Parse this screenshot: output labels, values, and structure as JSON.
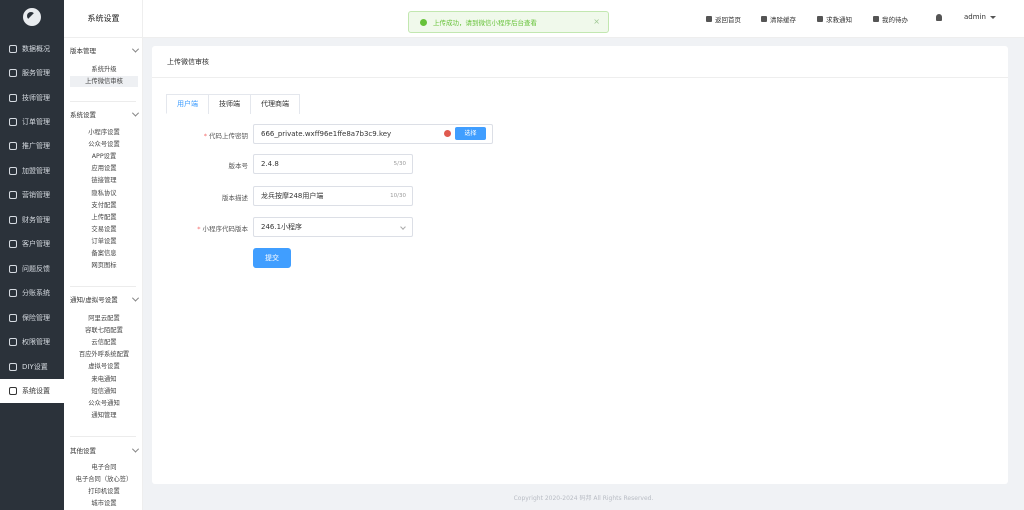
{
  "nav": {
    "items": [
      {
        "label": "数据概况",
        "icon": "dashboard-icon"
      },
      {
        "label": "服务管理",
        "icon": "service-icon"
      },
      {
        "label": "技师管理",
        "icon": "technician-icon"
      },
      {
        "label": "订单管理",
        "icon": "order-icon"
      },
      {
        "label": "推广管理",
        "icon": "promotion-icon"
      },
      {
        "label": "加盟管理",
        "icon": "franchise-icon"
      },
      {
        "label": "营销管理",
        "icon": "marketing-icon"
      },
      {
        "label": "财务管理",
        "icon": "finance-icon"
      },
      {
        "label": "客户管理",
        "icon": "customer-icon"
      },
      {
        "label": "问题反馈",
        "icon": "feedback-icon"
      },
      {
        "label": "分账系统",
        "icon": "split-icon"
      },
      {
        "label": "保险管理",
        "icon": "insurance-icon"
      },
      {
        "label": "权限管理",
        "icon": "permission-icon"
      },
      {
        "label": "DIY设置",
        "icon": "diy-icon"
      },
      {
        "label": "系统设置",
        "icon": "settings-icon"
      }
    ]
  },
  "sub": {
    "title": "系统设置",
    "groups": [
      {
        "title": "版本管理",
        "items": [
          "系统升级",
          "上传微信审核"
        ]
      },
      {
        "title": "系统设置",
        "items": [
          "小程序设置",
          "公众号设置",
          "APP设置",
          "应用设置",
          "链接管理",
          "隐私协议",
          "支付配置",
          "上传配置",
          "交易设置",
          "订单设置",
          "备案信息",
          "网页图标"
        ]
      },
      {
        "title": "通知/虚拟号设置",
        "items": [
          "阿里云配置",
          "容联七陌配置",
          "云信配置",
          "百应外呼系统配置",
          "虚拟号设置",
          "来电通知",
          "短信通知",
          "公众号通知",
          "通知管理"
        ]
      },
      {
        "title": "其他设置",
        "items": [
          "电子合同",
          "电子合同（放心签）",
          "打印机设置",
          "城市设置"
        ]
      }
    ]
  },
  "toast": {
    "message": "上传成功，请到微信小程序后台查看",
    "close": "×"
  },
  "topbar": {
    "links": [
      {
        "label": "返回首页",
        "icon": "home-icon"
      },
      {
        "label": "清除缓存",
        "icon": "clear-cache-icon"
      },
      {
        "label": "求救通知",
        "icon": "sos-icon"
      },
      {
        "label": "我的待办",
        "icon": "hourglass-icon"
      }
    ],
    "bell_icon": "bell-icon",
    "user": "admin"
  },
  "card": {
    "title": "上传微信审核",
    "tabs": [
      "用户端",
      "技师端",
      "代理商端"
    ],
    "form": {
      "key_label": "代码上传密钥",
      "key_value": "666_private.wxff96e1ffe8a7b3c9.key",
      "choose_label": "选择",
      "version_label": "版本号",
      "version_value": "2.4.8",
      "version_count": "5/30",
      "desc_label": "版本描述",
      "desc_value": "龙兵按摩248用户端",
      "desc_count": "10/30",
      "code_label": "小程序代码版本",
      "code_value": "246.1小程序",
      "submit_label": "提交"
    }
  },
  "footer": "Copyright 2020-2024 码邦 All Rights Reserved."
}
